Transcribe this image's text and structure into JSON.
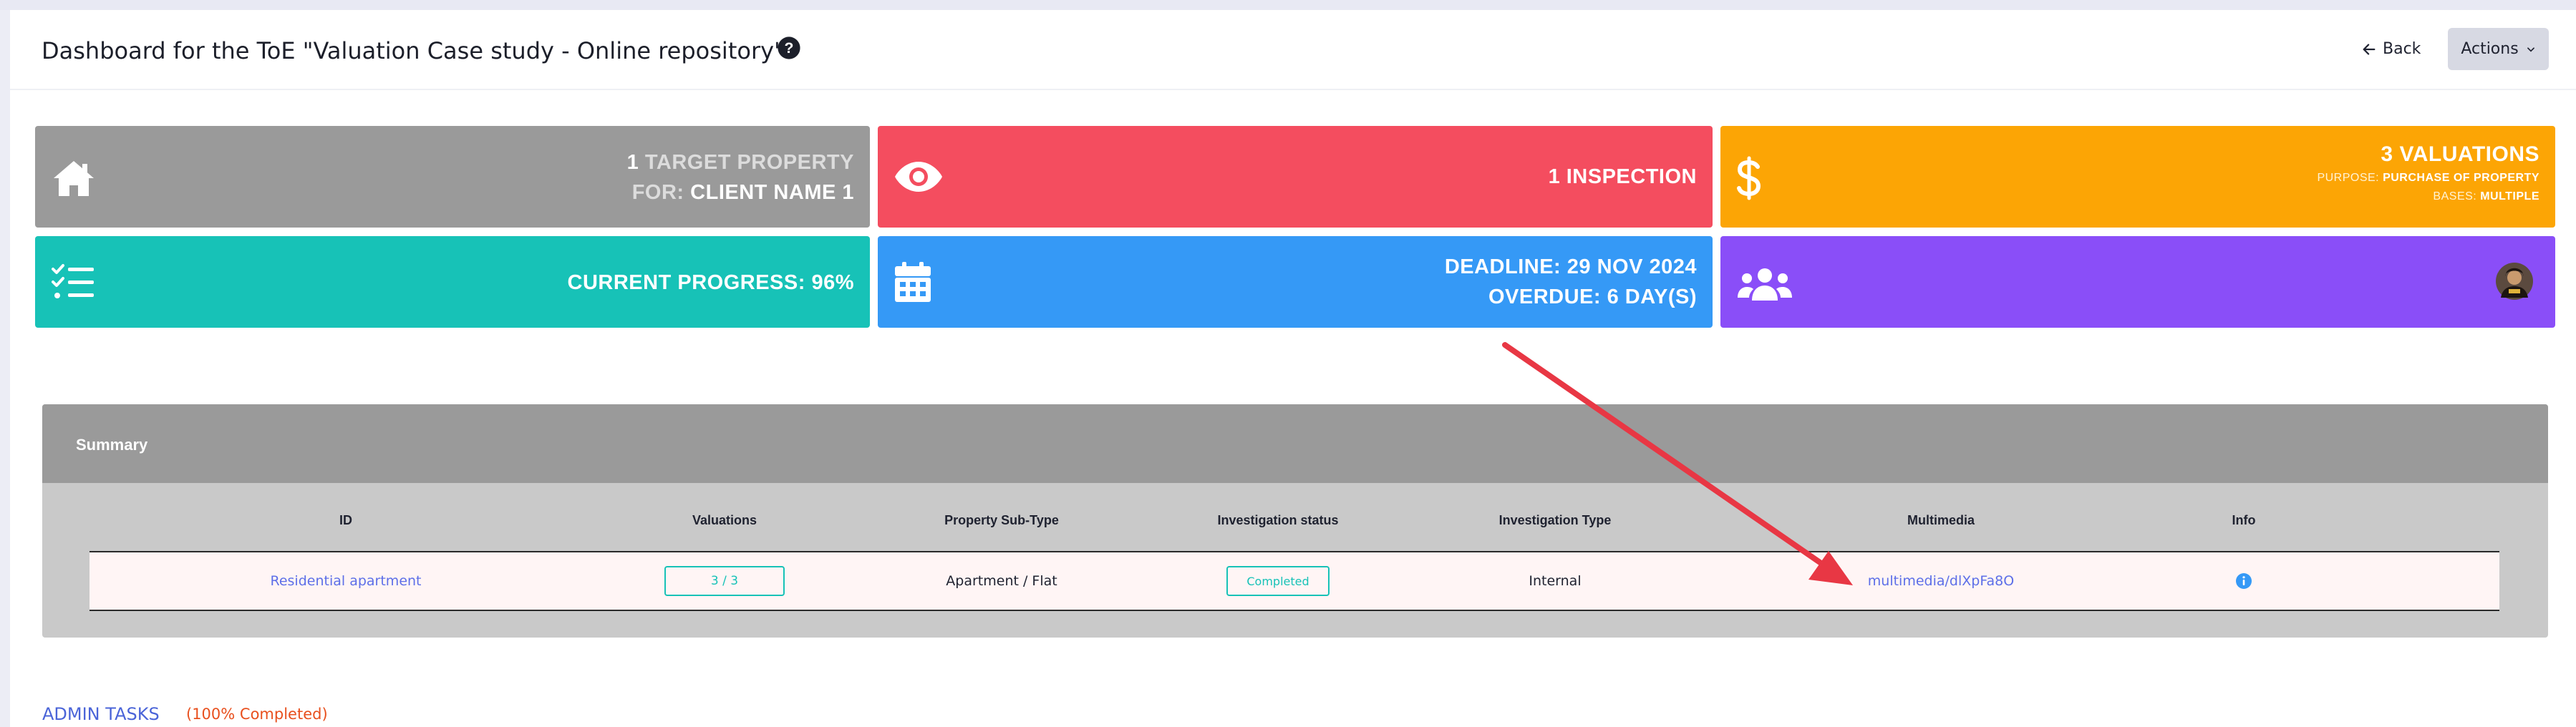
{
  "header": {
    "title": "Dashboard for the ToE \"Valuation Case study - Online repository\"",
    "back_label": "Back",
    "actions_label": "Actions"
  },
  "cards": {
    "property": {
      "count": "1",
      "label": "TARGET PROPERTY",
      "for_prefix": "FOR:",
      "client": "CLIENT NAME 1"
    },
    "inspection": {
      "text": "1 INSPECTION"
    },
    "valuations": {
      "text": "3 VALUATIONS",
      "purpose_prefix": "PURPOSE:",
      "purpose": "PURCHASE OF PROPERTY",
      "bases_prefix": "BASES:",
      "bases": "MULTIPLE"
    },
    "progress": {
      "text": "CURRENT PROGRESS: 96%",
      "percent": 96
    },
    "deadline": {
      "deadline": "DEADLINE: 29 NOV 2024",
      "overdue": "OVERDUE: 6 DAY(S)"
    }
  },
  "summary": {
    "title": "Summary",
    "columns": [
      "ID",
      "Valuations",
      "Property Sub-Type",
      "Investigation status",
      "Investigation Type",
      "Multimedia",
      "Info"
    ],
    "row": {
      "id": "Residential apartment",
      "valuations": "3 / 3",
      "sub_type": "Apartment / Flat",
      "status": "Completed",
      "type": "Internal",
      "multimedia": "multimedia/dlXpFa8O"
    }
  },
  "admin_tasks": {
    "label": "ADMIN TASKS",
    "completion": "(100% Completed)"
  },
  "colors": {
    "gray_card": "#9a9a9a",
    "red_card": "#f44d5f",
    "orange_card": "#fca505",
    "teal_card": "#17c2b7",
    "blue_card": "#3599f6",
    "purple_card": "#8a4ef8",
    "link": "#5d6fe8",
    "annotation_arrow": "#e83744"
  },
  "icons": {
    "help": "question-circle-icon",
    "back": "arrow-left-icon",
    "actions": "chevron-down-icon",
    "property": "home-icon",
    "inspection": "eye-icon",
    "valuations": "dollar-icon",
    "progress": "checklist-icon",
    "deadline": "calendar-icon",
    "team": "users-icon",
    "info": "info-circle-icon"
  }
}
